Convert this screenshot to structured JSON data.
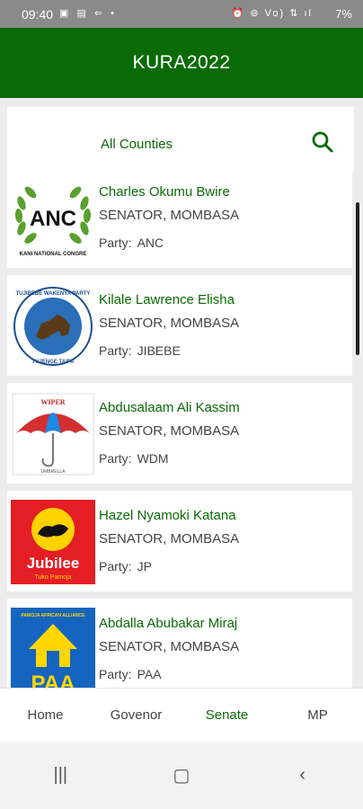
{
  "status_bar": {
    "time": "09:40",
    "battery": "7%",
    "left_icons": "▣ ▤ ⇐ •",
    "right_icons": "⏰ ⊚ Vo) ⇅ ıl"
  },
  "app_bar": {
    "title": "KURA2022"
  },
  "filter": {
    "county": "All Counties",
    "search_icon": "search-icon"
  },
  "candidates": [
    {
      "name": "Charles Okumu Bwire",
      "role": "SENATOR, MOMBASA",
      "party_label": "Party:",
      "party": "ANC",
      "logo_text": "ANC",
      "logo_sub": "KANI NATIONAL CONGRE"
    },
    {
      "name": "Kilale Lawrence Elisha",
      "role": "SENATOR, MOMBASA",
      "party_label": "Party:",
      "party": "JIBEBE",
      "logo_top": "TUJIBEBE WAKENYA PARTY",
      "logo_bottom": "TUJENGE TAIFA"
    },
    {
      "name": "Abdusalaam Ali Kassim",
      "role": "SENATOR, MOMBASA",
      "party_label": "Party:",
      "party": "WDM",
      "logo_top": "WIPER",
      "logo_bottom": "UMBRELLA"
    },
    {
      "name": "Hazel Nyamoki Katana",
      "role": "SENATOR, MOMBASA",
      "party_label": "Party:",
      "party": "JP",
      "logo_text": "Jubilee",
      "logo_sub": "Tuko Pamoja"
    },
    {
      "name": "Abdalla Abubakar Miraj",
      "role": "SENATOR, MOMBASA",
      "party_label": "Party:",
      "party": "PAA",
      "logo_text": "PAA",
      "logo_sub": "PAMOJA AFRICAN ALLIANCE"
    }
  ],
  "bottom_nav": [
    {
      "label": "Home",
      "active": false
    },
    {
      "label": "Govenor",
      "active": false
    },
    {
      "label": "Senate",
      "active": true
    },
    {
      "label": "MP",
      "active": false
    }
  ],
  "system_nav": {
    "recents": "|||",
    "home": "▢",
    "back": "‹"
  },
  "colors": {
    "primary": "#0a6b06",
    "status_bar": "#8a8a8a",
    "background": "#ececec"
  }
}
